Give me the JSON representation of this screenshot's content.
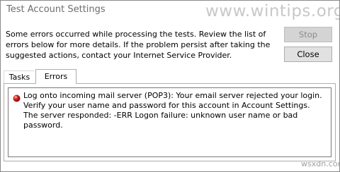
{
  "window": {
    "title": "Test Account Settings",
    "watermark": "www.wintips.org"
  },
  "message": "Some errors occurred while processing the tests. Review the list of errors below for more details. If the problem persist after taking the suggested actions, contact your Internet Service Provider.",
  "buttons": {
    "stop": "Stop",
    "close": "Close"
  },
  "tabs": [
    {
      "label": "Tasks"
    },
    {
      "label": "Errors"
    }
  ],
  "errors": [
    {
      "icon": "error-icon",
      "text": "Log onto incoming mail server (POP3): Your email server rejected your login. Verify your user name and password for this account in Account Settings.  The server responded: -ERR Logon failure: unknown user name or bad password."
    }
  ],
  "footer_mark": "wsxdn.com",
  "colors": {
    "error_icon": "#b0141b",
    "stop_disabled_bg": "#d4d4d4",
    "button_bg": "#e1e1e1"
  }
}
